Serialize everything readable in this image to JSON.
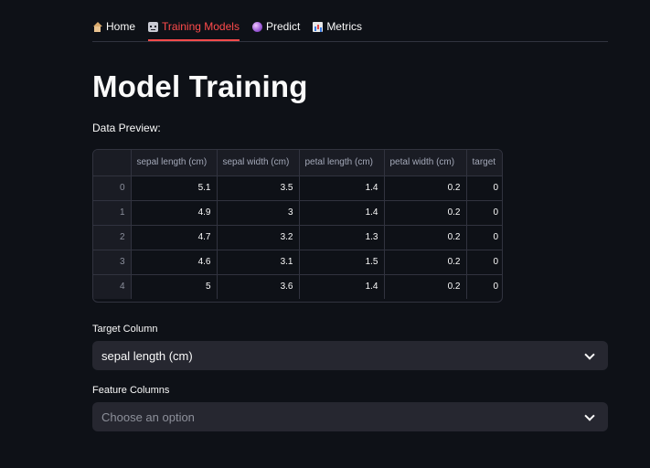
{
  "tabs": [
    {
      "label": "Home",
      "icon": "home-icon",
      "active": false
    },
    {
      "label": "Training Models",
      "icon": "robot-icon",
      "active": true
    },
    {
      "label": "Predict",
      "icon": "crystal-ball-icon",
      "active": false
    },
    {
      "label": "Metrics",
      "icon": "bar-chart-icon",
      "active": false
    }
  ],
  "accent_color": "#ff4b4b",
  "page_title": "Model Training",
  "preview_caption": "Data Preview:",
  "table": {
    "columns": [
      "",
      "sepal length (cm)",
      "sepal width (cm)",
      "petal length (cm)",
      "petal width (cm)",
      "target"
    ],
    "rows": [
      [
        "0",
        "5.1",
        "3.5",
        "1.4",
        "0.2",
        "0"
      ],
      [
        "1",
        "4.9",
        "3",
        "1.4",
        "0.2",
        "0"
      ],
      [
        "2",
        "4.7",
        "3.2",
        "1.3",
        "0.2",
        "0"
      ],
      [
        "3",
        "4.6",
        "3.1",
        "1.5",
        "0.2",
        "0"
      ],
      [
        "4",
        "5",
        "3.6",
        "1.4",
        "0.2",
        "0"
      ]
    ]
  },
  "target_select": {
    "label": "Target Column",
    "value": "sepal length (cm)"
  },
  "feature_select": {
    "label": "Feature Columns",
    "placeholder": "Choose an option"
  }
}
